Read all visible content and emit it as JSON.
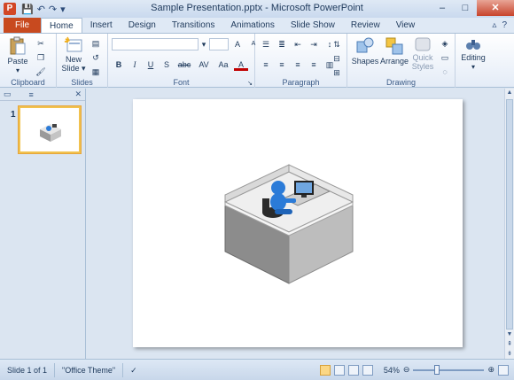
{
  "window": {
    "title": "Sample Presentation.pptx - Microsoft PowerPoint",
    "app_icon": "P",
    "qat_icons": [
      "save-icon",
      "undo-icon",
      "redo-icon",
      "customize-icon"
    ],
    "controls": {
      "minimize": "–",
      "maximize": "□",
      "close": "✕"
    }
  },
  "tabs": {
    "file": "File",
    "items": [
      "Home",
      "Insert",
      "Design",
      "Transitions",
      "Animations",
      "Slide Show",
      "Review",
      "View"
    ],
    "active": "Home"
  },
  "ribbon": {
    "clipboard": {
      "label": "Clipboard",
      "paste": "Paste"
    },
    "slides": {
      "label": "Slides",
      "new_slide": "New Slide"
    },
    "font": {
      "label": "Font",
      "bold": "B",
      "italic": "I",
      "underline": "U",
      "shadow": "S",
      "strike": "abc",
      "spacing": "AV",
      "case": "Aa",
      "grow": "A",
      "shrink": "A",
      "color": "A"
    },
    "paragraph": {
      "label": "Paragraph"
    },
    "drawing": {
      "label": "Drawing",
      "shapes": "Shapes",
      "arrange": "Arrange",
      "quick_styles": "Quick Styles"
    },
    "editing": {
      "label": "Editing"
    }
  },
  "slides_pane": {
    "slide_number": "1"
  },
  "statusbar": {
    "slide_info": "Slide 1 of 1",
    "theme": "\"Office Theme\"",
    "zoom": "54%",
    "zoom_fraction": 0.54
  },
  "colors": {
    "file_tab": "#c84a1f",
    "accent": "#2b7bd8",
    "selection": "#f1c24f"
  }
}
